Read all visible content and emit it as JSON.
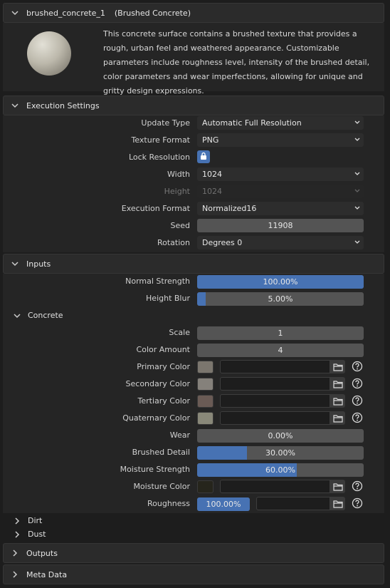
{
  "header": {
    "node_name": "brushed_concrete_1",
    "node_type": "(Brushed Concrete)"
  },
  "description": "This concrete surface contains a brushed texture that provides a rough, urban feel and weathered appearance. Customizable parameters include roughness level, intensity of the brushed detail, color parameters and wear imperfections, allowing for unique and gritty design expressions.",
  "execution": {
    "title": "Execution Settings",
    "update_type_label": "Update Type",
    "update_type": "Automatic Full Resolution",
    "texture_format_label": "Texture Format",
    "texture_format": "PNG",
    "lock_resolution_label": "Lock Resolution",
    "lock_resolution": true,
    "width_label": "Width",
    "width": "1024",
    "height_label": "Height",
    "height": "1024",
    "execution_format_label": "Execution Format",
    "execution_format": "Normalized16",
    "seed_label": "Seed",
    "seed": "11908",
    "rotation_label": "Rotation",
    "rotation": "Degrees 0"
  },
  "inputs": {
    "title": "Inputs",
    "normal_strength_label": "Normal Strength",
    "normal_strength": "100.00%",
    "normal_strength_frac": 1.0,
    "height_blur_label": "Height Blur",
    "height_blur": "5.00%",
    "height_blur_frac": 0.05
  },
  "concrete": {
    "title": "Concrete",
    "scale_label": "Scale",
    "scale": "1",
    "color_amount_label": "Color Amount",
    "color_amount": "4",
    "primary_color_label": "Primary Color",
    "primary_color": "#7b766e",
    "secondary_color_label": "Secondary Color",
    "secondary_color": "#85817b",
    "tertiary_color_label": "Tertiary Color",
    "tertiary_color": "#6a5b55",
    "quaternary_color_label": "Quaternary Color",
    "quaternary_color": "#898879",
    "wear_label": "Wear",
    "wear": "0.00%",
    "wear_frac": 0.0,
    "brushed_detail_label": "Brushed Detail",
    "brushed_detail": "30.00%",
    "brushed_detail_frac": 0.3,
    "moisture_strength_label": "Moisture Strength",
    "moisture_strength": "60.00%",
    "moisture_strength_frac": 0.6,
    "moisture_color_label": "Moisture Color",
    "moisture_color": "#26251c",
    "roughness_label": "Roughness",
    "roughness": "100.00%",
    "roughness_frac": 1.0
  },
  "collapsed": {
    "dirt": "Dirt",
    "dust": "Dust"
  },
  "outputs": {
    "title": "Outputs"
  },
  "meta": {
    "title": "Meta Data"
  },
  "accent": "#4772b3"
}
